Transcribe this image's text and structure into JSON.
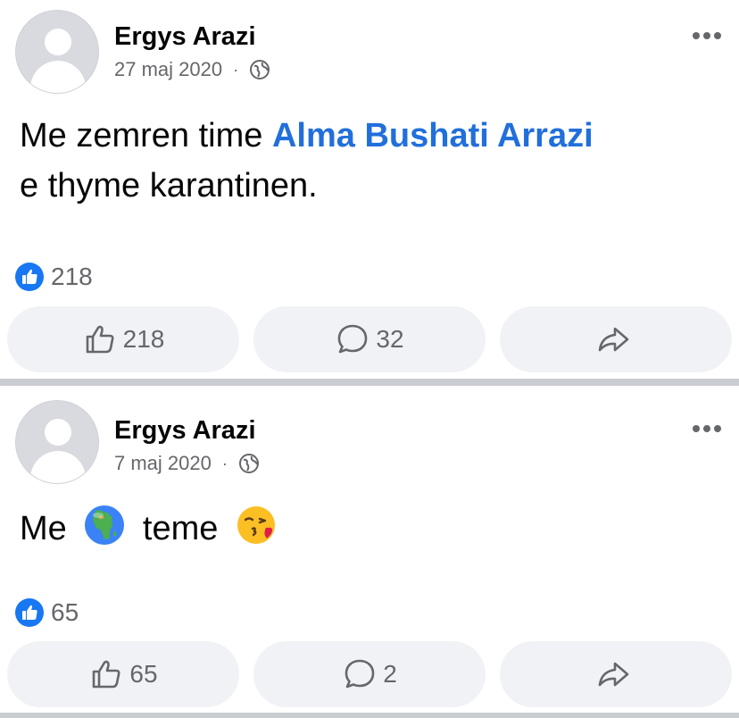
{
  "posts": [
    {
      "author": "Ergys Arazi",
      "date": "27 maj 2020",
      "meta_separator": "·",
      "privacy_icon": "globe-icon",
      "text_before": "Me zemren time ",
      "mention": "Alma Bushati Arrazi",
      "text_after": "e thyme karantinen.",
      "reaction_count": "218",
      "actions": {
        "like_count": "218",
        "comment_count": "32",
        "share_label": ""
      }
    },
    {
      "author": "Ergys Arazi",
      "date": "7 maj 2020",
      "meta_separator": "·",
      "privacy_icon": "globe-icon",
      "text_word_1": "Me",
      "emoji_1": "globe-africa-emoji",
      "text_word_2": "teme",
      "emoji_2": "kissing-heart-emoji",
      "reaction_count": "65",
      "actions": {
        "like_count": "65",
        "comment_count": "2",
        "share_label": ""
      }
    }
  ],
  "colors": {
    "mention": "#216fdb",
    "like_badge": "#1877f2",
    "secondary_text": "#65676b",
    "button_bg": "#f0f2f5",
    "separator": "#c9ccd1"
  }
}
